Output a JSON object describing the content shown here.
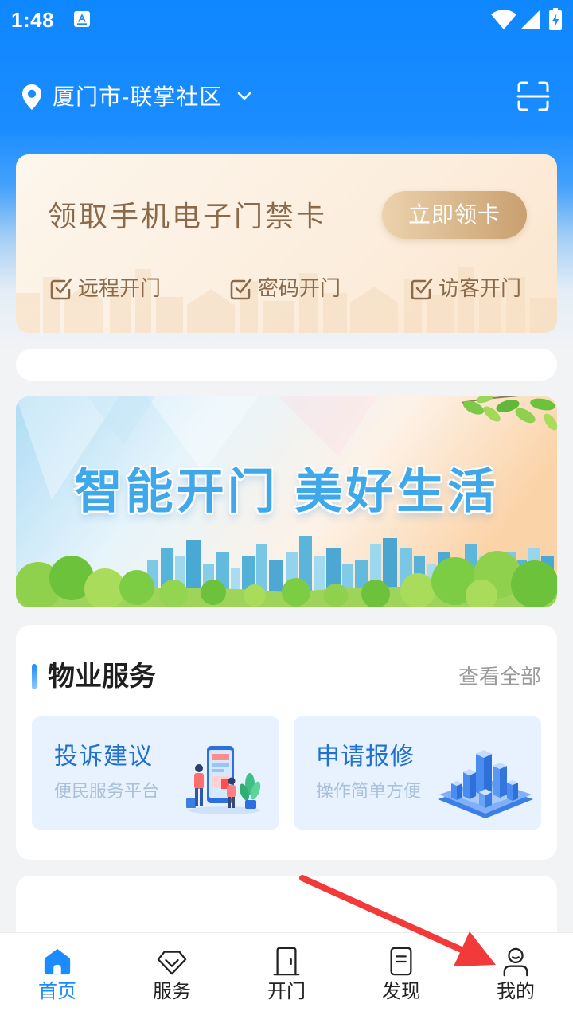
{
  "status_bar": {
    "time": "1:48",
    "icons": [
      "notification-a-icon",
      "wifi-icon",
      "signal-icon",
      "battery-charging-icon"
    ]
  },
  "header": {
    "location": "厦门市-联掌社区",
    "location_icon": "location-pin-icon",
    "dropdown_icon": "chevron-down-icon",
    "scan_icon": "scan-icon"
  },
  "door_card": {
    "title": "领取手机电子门禁卡",
    "button_label": "立即领卡",
    "features": [
      "远程开门",
      "密码开门",
      "访客开门"
    ],
    "feature_icon": "checkbox-checked-icon"
  },
  "banner": {
    "headline": "智能开门 美好生活"
  },
  "property_services": {
    "title": "物业服务",
    "view_all": "查看全部",
    "tiles": [
      {
        "title": "投诉建议",
        "subtitle": "便民服务平台",
        "illustration": "complaint-illustration"
      },
      {
        "title": "申请报修",
        "subtitle": "操作简单方便",
        "illustration": "repair-city-illustration"
      }
    ]
  },
  "bottom_nav": {
    "active_index": 0,
    "items": [
      {
        "label": "首页",
        "icon": "home-icon"
      },
      {
        "label": "服务",
        "icon": "diamond-icon"
      },
      {
        "label": "开门",
        "icon": "door-icon"
      },
      {
        "label": "发现",
        "icon": "document-icon"
      },
      {
        "label": "我的",
        "icon": "person-icon"
      }
    ]
  },
  "annotation": {
    "icon": "red-arrow-icon"
  },
  "colors": {
    "brand_blue": "#1a8cff",
    "gold_text": "#8a6a4b",
    "gold_button_start": "#ecd2ae",
    "gold_button_end": "#c9a06f",
    "tile_background": "#e8f2fe",
    "tile_title": "#2070d0",
    "tile_subtitle": "#a9c0d8",
    "page_background": "#f2f3f5",
    "nav_text": "#222222",
    "annotation_red": "#f23a3a"
  }
}
